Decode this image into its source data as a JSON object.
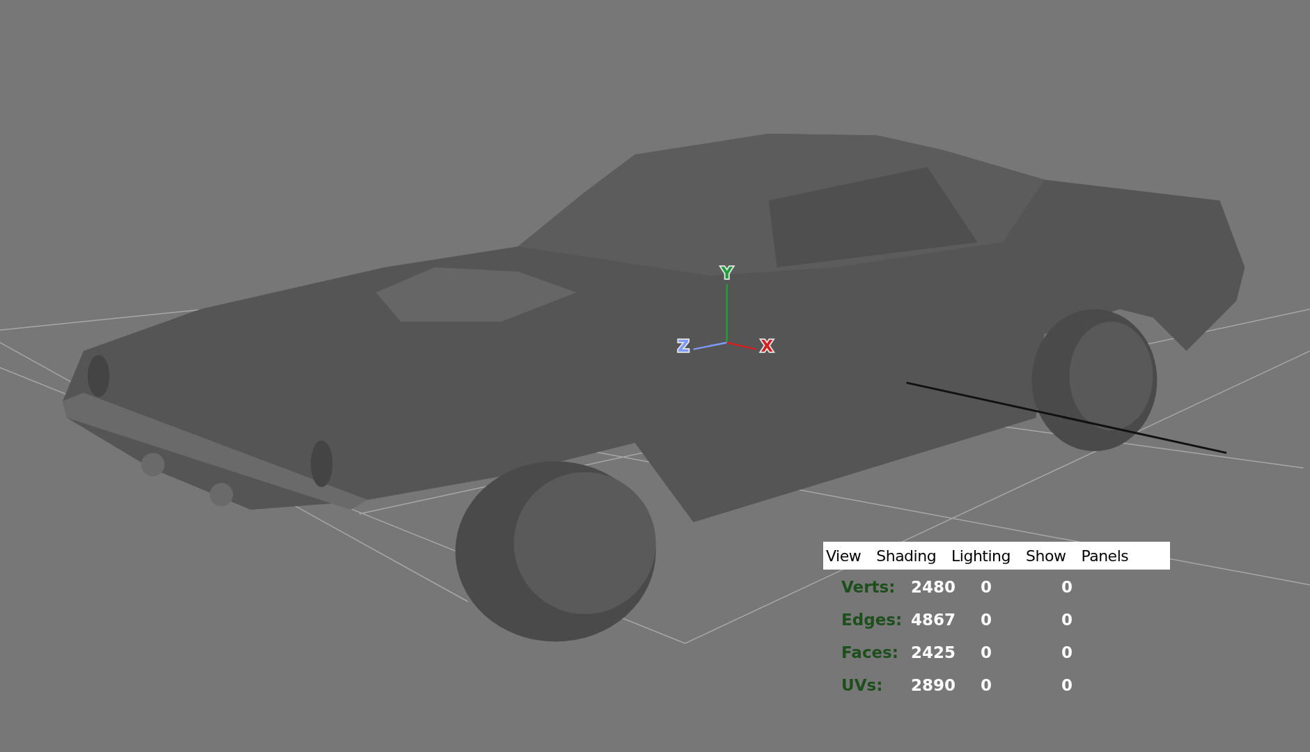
{
  "axes": [
    {
      "kind": "y",
      "label": "Y",
      "color": "#1fa03c"
    },
    {
      "kind": "z",
      "label": "Z",
      "color": "#7f9bff"
    },
    {
      "kind": "x",
      "label": "X",
      "color": "#d42020"
    }
  ],
  "menu_bar": {
    "items": [
      "View",
      "Shading",
      "Lighting",
      "Show",
      "Panels"
    ]
  },
  "stats": [
    {
      "label": "Verts:",
      "values": [
        "2480",
        "0",
        "0"
      ]
    },
    {
      "label": "Edges:",
      "values": [
        "4867",
        "0",
        "0"
      ]
    },
    {
      "label": "Faces:",
      "values": [
        "2425",
        "0",
        "0"
      ]
    },
    {
      "label": "UVs:",
      "values": [
        "2890",
        "0",
        "0"
      ]
    }
  ]
}
